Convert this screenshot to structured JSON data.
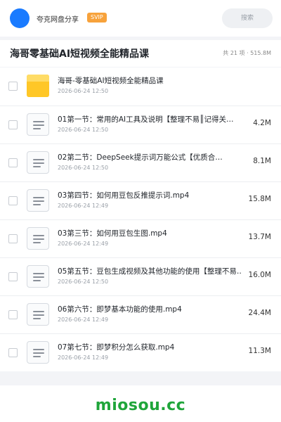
{
  "header": {
    "brand": "夸克网盘分享",
    "badge": "SVIP",
    "search_label": "搜索",
    "icons": {
      "avatar": "avatar-circle"
    },
    "colors": {
      "avatar": "#1a7bff",
      "badge": "#f7a23b"
    }
  },
  "folder": {
    "title": "海哥零基础AI短视频全能精品课",
    "meta": "共 21 项 · 515.8M"
  },
  "files": [
    {
      "icon": "folder-icon",
      "name": "海哥-零基础AI短视频全能精品课",
      "date": "2026-06-24 12:50",
      "size": ""
    },
    {
      "icon": "document-icon",
      "name": "01第一节：常用的AI工具及说明【整理不易║记得关…",
      "date": "2026-06-24 12:50",
      "size": "4.2M"
    },
    {
      "icon": "document-icon",
      "name": "02第二节：DeepSeek提示词万能公式【优质合…",
      "date": "2026-06-24 12:50",
      "size": "8.1M"
    },
    {
      "icon": "document-icon",
      "name": "03第四节：如何用豆包反推提示词.mp4",
      "date": "2026-06-24 12:49",
      "size": "15.8M"
    },
    {
      "icon": "document-icon",
      "name": "03第三节：如何用豆包生图.mp4",
      "date": "2026-06-24 12:49",
      "size": "13.7M"
    },
    {
      "icon": "document-icon",
      "name": "05第五节：豆包生成视频及其他功能的使用【整理不易…",
      "date": "2026-06-24 12:50",
      "size": "16.0M"
    },
    {
      "icon": "document-icon",
      "name": "06第六节：即梦基本功能的使用.mp4",
      "date": "2026-06-24 12:49",
      "size": "24.4M"
    },
    {
      "icon": "document-icon",
      "name": "07第七节：即梦积分怎么获取.mp4",
      "date": "2026-06-24 12:49",
      "size": "11.3M"
    }
  ],
  "watermark": {
    "text": "miosou.cc",
    "color": "#1fa53a"
  }
}
